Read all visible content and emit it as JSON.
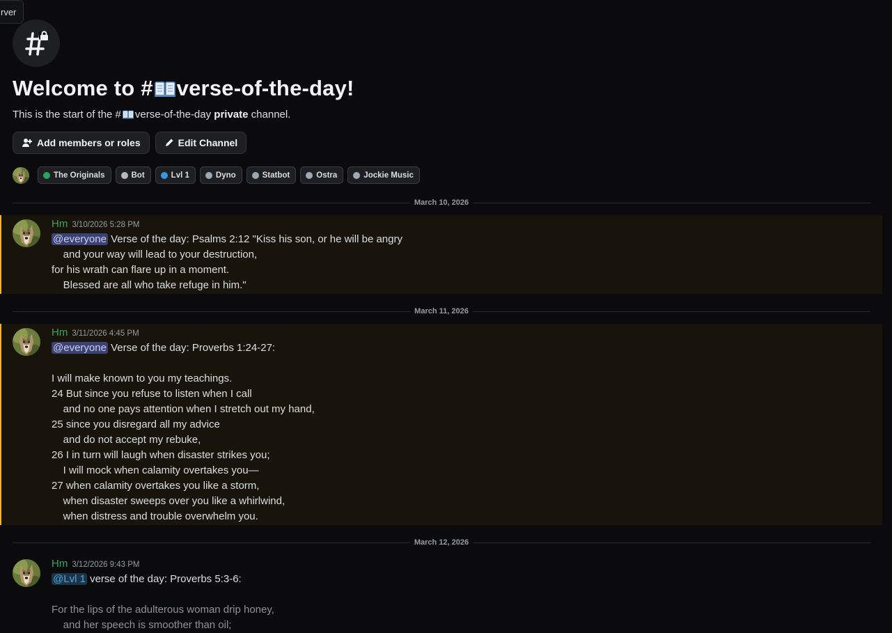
{
  "tooltip": {
    "text": "rver"
  },
  "channel": {
    "title_prefix": "Welcome to #",
    "title_suffix": "verse-of-the-day!",
    "sub_prefix": "This is the start of the #",
    "sub_channel": "verse-of-the-day",
    "sub_private": "private",
    "sub_suffix": " channel."
  },
  "buttons": {
    "add_members": "Add members or roles",
    "edit_channel": "Edit Channel"
  },
  "roles": [
    {
      "name": "The Originals",
      "color": "#23a55a"
    },
    {
      "name": "Bot",
      "color": "#b5bac1"
    },
    {
      "name": "Lvl 1",
      "color": "#3498db"
    },
    {
      "name": "Dyno",
      "color": "#99aab5"
    },
    {
      "name": "Statbot",
      "color": "#99aab5"
    },
    {
      "name": "Ostra",
      "color": "#99aab5"
    },
    {
      "name": "Jockie Music",
      "color": "#99aab5"
    }
  ],
  "colors": {
    "accent_highlight": "#f0b232",
    "author": "#3ba55c"
  },
  "dates": [
    "March 10, 2026",
    "March 11, 2026",
    "March 12, 2026"
  ],
  "messages": [
    {
      "author": "Hm",
      "timestamp": "3/10/2026 5:28 PM",
      "mention": "@everyone",
      "first_line": " Verse of the day: Psalms 2:12 \"Kiss his son, or he will be angry",
      "lines": [
        "    and your way will lead to your destruction,",
        "for his wrath can flare up in a moment.",
        "    Blessed are all who take refuge in him.\""
      ]
    },
    {
      "author": "Hm",
      "timestamp": "3/11/2026 4:45 PM",
      "mention": "@everyone",
      "first_line": " Verse of the day: Proverbs 1:24-27:",
      "lines": [
        "",
        "I will make known to you my teachings.",
        "24 But since you refuse to listen when I call",
        "    and no one pays attention when I stretch out my hand,",
        "25 since you disregard all my advice",
        "    and do not accept my rebuke,",
        "26 I in turn will laugh when disaster strikes you;",
        "    I will mock when calamity overtakes you—",
        "27 when calamity overtakes you like a storm,",
        "    when disaster sweeps over you like a whirlwind,",
        "    when distress and trouble overwhelm you."
      ]
    },
    {
      "author": "Hm",
      "timestamp": "3/12/2026 9:43 PM",
      "mention": "@Lvl 1",
      "first_line": " verse of the day: Proverbs 5:3-6:",
      "lines": [
        "",
        "For the lips of the adulterous woman drip honey,",
        "    and her speech is smoother than oil;"
      ]
    }
  ]
}
